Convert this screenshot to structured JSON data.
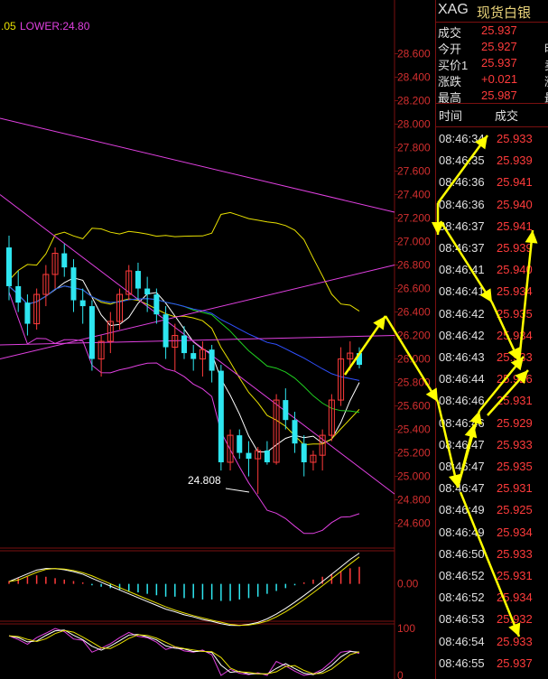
{
  "chart_header": {
    "upper_fragment": ".05",
    "lower_label": "LOWER:24.80"
  },
  "chart_data": [
    {
      "type": "candlestick",
      "title": "",
      "yticks": [
        "28.600",
        "28.400",
        "28.200",
        "28.000",
        "27.800",
        "27.600",
        "27.400",
        "27.200",
        "27.000",
        "26.800",
        "26.600",
        "26.400",
        "26.200",
        "26.000",
        "25.800",
        "25.600",
        "25.400",
        "25.200",
        "25.000",
        "24.800",
        "24.600"
      ],
      "ylim": [
        24.52,
        28.75
      ],
      "annotation": {
        "text": "24.808",
        "value": 24.808
      },
      "candles": [
        {
          "o": 26.95,
          "h": 27.05,
          "l": 26.5,
          "c": 26.62
        },
        {
          "o": 26.62,
          "h": 26.75,
          "l": 26.4,
          "c": 26.48
        },
        {
          "o": 26.48,
          "h": 26.55,
          "l": 26.2,
          "c": 26.3
        },
        {
          "o": 26.3,
          "h": 26.6,
          "l": 26.25,
          "c": 26.55
        },
        {
          "o": 26.55,
          "h": 26.8,
          "l": 26.45,
          "c": 26.72
        },
        {
          "o": 26.72,
          "h": 26.95,
          "l": 26.6,
          "c": 26.9
        },
        {
          "o": 26.9,
          "h": 26.98,
          "l": 26.7,
          "c": 26.78
        },
        {
          "o": 26.78,
          "h": 26.85,
          "l": 26.4,
          "c": 26.5
        },
        {
          "o": 26.5,
          "h": 26.6,
          "l": 26.3,
          "c": 26.45
        },
        {
          "o": 26.45,
          "h": 26.5,
          "l": 25.9,
          "c": 26.0
        },
        {
          "o": 26.0,
          "h": 26.2,
          "l": 25.85,
          "c": 26.15
        },
        {
          "o": 26.15,
          "h": 26.4,
          "l": 26.05,
          "c": 26.32
        },
        {
          "o": 26.32,
          "h": 26.6,
          "l": 26.25,
          "c": 26.55
        },
        {
          "o": 26.55,
          "h": 26.8,
          "l": 26.5,
          "c": 26.75
        },
        {
          "o": 26.75,
          "h": 26.82,
          "l": 26.5,
          "c": 26.6
        },
        {
          "o": 26.6,
          "h": 26.7,
          "l": 26.4,
          "c": 26.55
        },
        {
          "o": 26.55,
          "h": 26.6,
          "l": 26.3,
          "c": 26.38
        },
        {
          "o": 26.38,
          "h": 26.45,
          "l": 26.0,
          "c": 26.1
        },
        {
          "o": 26.1,
          "h": 26.3,
          "l": 25.9,
          "c": 26.2
        },
        {
          "o": 26.2,
          "h": 26.28,
          "l": 26.0,
          "c": 26.05
        },
        {
          "o": 26.05,
          "h": 26.12,
          "l": 25.9,
          "c": 26.0
        },
        {
          "o": 26.0,
          "h": 26.15,
          "l": 25.85,
          "c": 26.08
        },
        {
          "o": 26.08,
          "h": 26.12,
          "l": 25.8,
          "c": 25.9
        },
        {
          "o": 25.9,
          "h": 25.95,
          "l": 25.05,
          "c": 25.12
        },
        {
          "o": 25.12,
          "h": 25.4,
          "l": 25.05,
          "c": 25.35
        },
        {
          "o": 25.35,
          "h": 25.4,
          "l": 25.15,
          "c": 25.2
        },
        {
          "o": 25.2,
          "h": 25.3,
          "l": 25.0,
          "c": 25.15
        },
        {
          "o": 25.15,
          "h": 25.25,
          "l": 24.85,
          "c": 25.22
        },
        {
          "o": 25.22,
          "h": 25.3,
          "l": 25.1,
          "c": 25.12
        },
        {
          "o": 25.12,
          "h": 25.7,
          "l": 25.1,
          "c": 25.65
        },
        {
          "o": 25.65,
          "h": 25.75,
          "l": 25.4,
          "c": 25.48
        },
        {
          "o": 25.48,
          "h": 25.55,
          "l": 25.2,
          "c": 25.28
        },
        {
          "o": 25.28,
          "h": 25.35,
          "l": 25.0,
          "c": 25.12
        },
        {
          "o": 25.12,
          "h": 25.22,
          "l": 25.05,
          "c": 25.18
        },
        {
          "o": 25.18,
          "h": 25.4,
          "l": 25.05,
          "c": 25.35
        },
        {
          "o": 25.35,
          "h": 25.7,
          "l": 25.3,
          "c": 25.65
        },
        {
          "o": 25.65,
          "h": 26.1,
          "l": 25.6,
          "c": 26.0
        },
        {
          "o": 26.0,
          "h": 26.15,
          "l": 25.9,
          "c": 26.05
        },
        {
          "o": 26.05,
          "h": 26.1,
          "l": 25.92,
          "c": 25.95
        }
      ]
    },
    {
      "type": "bar",
      "yticks": [
        "0.00"
      ],
      "ylim": [
        -0.25,
        0.22
      ],
      "values": [
        0.02,
        0.04,
        0.05,
        0.06,
        0.05,
        0.04,
        0.03,
        0.02,
        0.01,
        -0.01,
        -0.02,
        -0.03,
        -0.04,
        -0.05,
        -0.06,
        -0.07,
        -0.08,
        -0.09,
        -0.09,
        -0.1,
        -0.1,
        -0.11,
        -0.11,
        -0.12,
        -0.12,
        -0.11,
        -0.1,
        -0.09,
        -0.07,
        -0.05,
        -0.03,
        -0.01,
        0.01,
        0.03,
        0.05,
        0.07,
        0.09,
        0.11,
        0.12
      ]
    },
    {
      "type": "line",
      "yticks": [
        "100",
        "0"
      ],
      "ylim": [
        0,
        100
      ]
    }
  ],
  "quote": {
    "symbol": "XAG",
    "name": "现货白银",
    "rows": [
      {
        "label": "成交",
        "value": "25.937",
        "cut": ""
      },
      {
        "label": "今开",
        "value": "25.927",
        "cut": "明"
      },
      {
        "label": "买价1",
        "value": "25.937",
        "cut": "卖"
      },
      {
        "label": "涨跌",
        "value": "+0.021",
        "cut": "涨"
      },
      {
        "label": "最高",
        "value": "25.987",
        "cut": "最"
      }
    ]
  },
  "ticks_table": {
    "headers": [
      "时间",
      "成交"
    ],
    "rows": [
      {
        "time": "08:46:34",
        "price": "25.933"
      },
      {
        "time": "08:46:35",
        "price": "25.939"
      },
      {
        "time": "08:46:36",
        "price": "25.941"
      },
      {
        "time": "08:46:36",
        "price": "25.940"
      },
      {
        "time": "08:46:37",
        "price": "25.941"
      },
      {
        "time": "08:46:37",
        "price": "25.939"
      },
      {
        "time": "08:46:41",
        "price": "25.940"
      },
      {
        "time": "08:46:41",
        "price": "25.934"
      },
      {
        "time": "08:46:42",
        "price": "25.935"
      },
      {
        "time": "08:46:42",
        "price": "25.934"
      },
      {
        "time": "08:46:43",
        "price": "25.933"
      },
      {
        "time": "08:46:44",
        "price": "25.926"
      },
      {
        "time": "08:46:46",
        "price": "25.931"
      },
      {
        "time": "08:46:46",
        "price": "25.929"
      },
      {
        "time": "08:46:47",
        "price": "25.933"
      },
      {
        "time": "08:46:47",
        "price": "25.935"
      },
      {
        "time": "08:46:47",
        "price": "25.931"
      },
      {
        "time": "08:46:49",
        "price": "25.925"
      },
      {
        "time": "08:46:49",
        "price": "25.934"
      },
      {
        "time": "08:46:50",
        "price": "25.933"
      },
      {
        "time": "08:46:52",
        "price": "25.931"
      },
      {
        "time": "08:46:52",
        "price": "25.934"
      },
      {
        "time": "08:46:53",
        "price": "25.932"
      },
      {
        "time": "08:46:54",
        "price": "25.933"
      },
      {
        "time": "08:46:55",
        "price": "25.937"
      }
    ]
  },
  "colors": {
    "up": "#ff3b3b",
    "down": "#2ee6f0",
    "axis": "#7a1010",
    "text": "#d32f2f",
    "arrow": "#ffff00"
  }
}
